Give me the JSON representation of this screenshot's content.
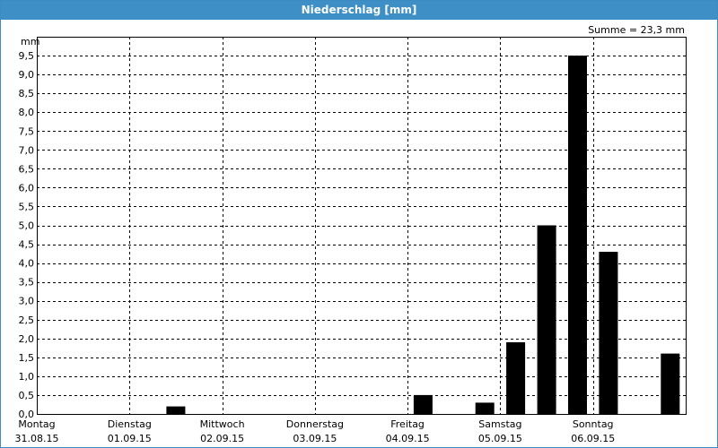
{
  "window": {
    "title": "Niederschlag [mm]"
  },
  "chart_data": {
    "type": "bar",
    "title": "Niederschlag [mm]",
    "ylabel": "mm",
    "summary": "Summe = 23,3 mm",
    "ylim": [
      0,
      10
    ],
    "yticks": [
      "0,0",
      "0,5",
      "1,0",
      "1,5",
      "2,0",
      "2,5",
      "3,0",
      "3,5",
      "4,0",
      "4,5",
      "5,0",
      "5,5",
      "6,0",
      "6,5",
      "7,0",
      "7,5",
      "8,0",
      "8,5",
      "9,0",
      "9,5"
    ],
    "day_labels": [
      {
        "day": "Montag",
        "date": "31.08.15"
      },
      {
        "day": "Dienstag",
        "date": "01.09.15"
      },
      {
        "day": "Mittwoch",
        "date": "02.09.15"
      },
      {
        "day": "Donnerstag",
        "date": "03.09.15"
      },
      {
        "day": "Freitag",
        "date": "04.09.15"
      },
      {
        "day": "Samstag",
        "date": "05.09.15"
      },
      {
        "day": "Sonntag",
        "date": "06.09.15"
      }
    ],
    "bar_interval_hours": 8,
    "values": [
      0,
      0,
      0,
      0,
      0.2,
      0,
      0,
      0,
      0,
      0,
      0,
      0,
      0.5,
      0,
      0.3,
      1.9,
      5.0,
      9.5,
      4.3,
      0,
      1.6
    ],
    "bar_color": "#000000",
    "grid": true
  }
}
